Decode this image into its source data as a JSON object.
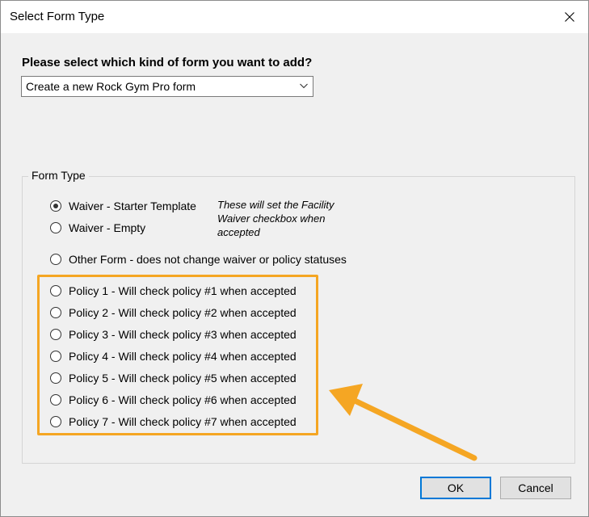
{
  "window": {
    "title": "Select Form Type"
  },
  "prompt": "Please select which kind of form you want to add?",
  "form_kind_select": {
    "selected": "Create a new Rock Gym Pro form"
  },
  "form_type_group": {
    "legend": "Form Type",
    "waiver_options": [
      {
        "label": "Waiver - Starter Template",
        "checked": true
      },
      {
        "label": "Waiver - Empty",
        "checked": false
      }
    ],
    "waiver_note": "These will set the Facility Waiver checkbox when accepted",
    "other_option": {
      "label": "Other Form - does not change waiver or policy statuses",
      "checked": false
    },
    "policy_options": [
      {
        "label": "Policy 1 - Will check policy #1 when accepted",
        "checked": false
      },
      {
        "label": "Policy 2 - Will check policy #2 when accepted",
        "checked": false
      },
      {
        "label": "Policy 3 - Will check policy #3 when accepted",
        "checked": false
      },
      {
        "label": "Policy 4 - Will check policy #4 when accepted",
        "checked": false
      },
      {
        "label": "Policy 5 - Will check policy #5 when accepted",
        "checked": false
      },
      {
        "label": "Policy 6 - Will check policy #6 when accepted",
        "checked": false
      },
      {
        "label": "Policy 7 - Will check policy #7 when accepted",
        "checked": false
      }
    ]
  },
  "buttons": {
    "ok": "OK",
    "cancel": "Cancel"
  },
  "icons": {
    "close": "close-icon",
    "dropdown": "chevron-down-icon",
    "annotation": "arrow-annotation"
  },
  "colors": {
    "highlight": "#f5a623",
    "focus_border": "#0078d7",
    "dialog_bg": "#f0f0f0"
  }
}
